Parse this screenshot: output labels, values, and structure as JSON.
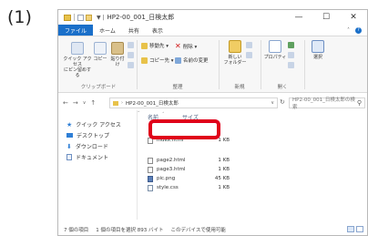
{
  "step_label": "(1)",
  "window": {
    "title": "HP2-00_001_日検太郎",
    "controls": {
      "minimize": "—",
      "maximize": "☐",
      "close": "✕"
    }
  },
  "ribbon_tabs": [
    "ファイル",
    "ホーム",
    "共有",
    "表示"
  ],
  "ribbon": {
    "clipboard": {
      "pin_label": "クイック アクセス\nにピン留めする",
      "copy_label": "コピー",
      "paste_label": "貼り付け",
      "group_label": "クリップボード"
    },
    "organize": {
      "move_to": "移動先 ▾",
      "delete": "削除 ▾",
      "copy_to": "コピー先 ▾",
      "rename": "名前の変更",
      "group_label": "整理"
    },
    "new": {
      "new_folder": "新しい\nフォルダー",
      "group_label": "新規"
    },
    "open": {
      "properties": "プロパティ",
      "group_label": "開く"
    },
    "select": {
      "select": "選択"
    }
  },
  "address": {
    "path": "HP2-00_001_日検太郎",
    "search_placeholder": "HP2-00_001_日検太郎の検索"
  },
  "nav_pane": {
    "items": [
      {
        "label": "クイック アクセス",
        "icon": "star-icon"
      },
      {
        "label": "デスクトップ",
        "icon": "desktop-icon"
      },
      {
        "label": "ダウンロード",
        "icon": "download-icon"
      },
      {
        "label": "ドキュメント",
        "icon": "document-icon"
      }
    ]
  },
  "columns": {
    "name": "名前",
    "size": "サイズ"
  },
  "files": [
    {
      "name": "index.html",
      "size": "1 KB",
      "type": "html"
    },
    {
      "name": "page2.html",
      "size": "1 KB",
      "type": "html"
    },
    {
      "name": "page3.html",
      "size": "1 KB",
      "type": "html"
    },
    {
      "name": "pic.png",
      "size": "45 KB",
      "type": "png"
    },
    {
      "name": "style.css",
      "size": "1 KB",
      "type": "css"
    }
  ],
  "status": {
    "item_count": "7 個の項目",
    "selected": "1 個の項目を選択 893 バイト",
    "availability": "このデバイスで使用可能"
  },
  "colors": {
    "highlight": "#e0001a",
    "file_tab": "#1a6fc9"
  }
}
